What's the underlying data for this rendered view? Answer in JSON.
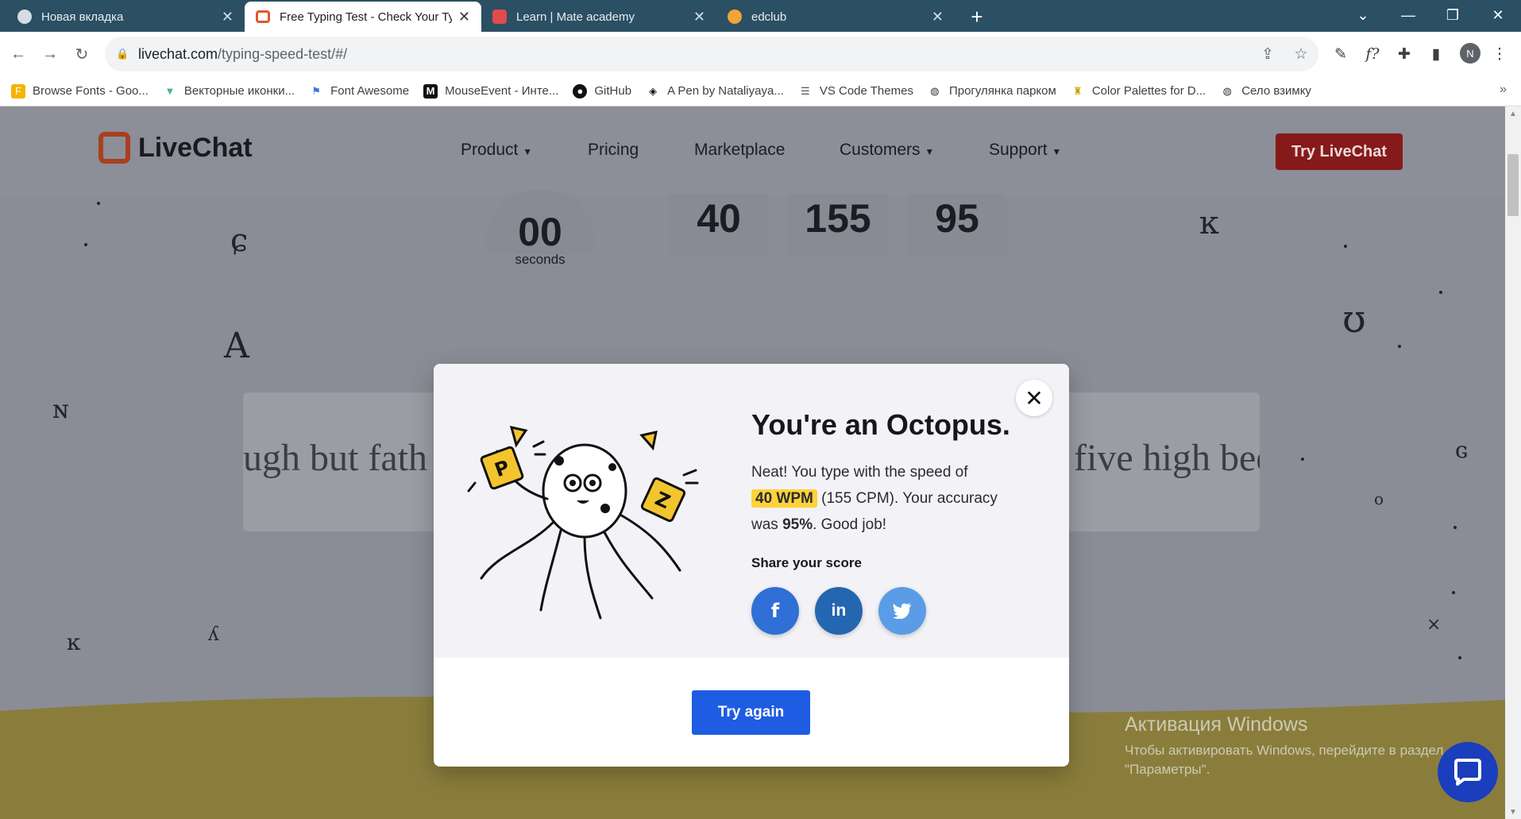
{
  "browser": {
    "tabs": [
      {
        "title": "Новая вкладка",
        "active": false
      },
      {
        "title": "Free Typing Test - Check Your Ty",
        "active": true
      },
      {
        "title": "Learn | Mate academy",
        "active": false
      },
      {
        "title": "edclub",
        "active": false
      }
    ],
    "url_domain": "livechat.com",
    "url_path": "/typing-speed-test/#/",
    "profile_initial": "N",
    "bookmarks": [
      {
        "label": "Browse Fonts - Goo...",
        "icon": "google-fonts-icon"
      },
      {
        "label": "Векторные иконки...",
        "icon": "vue-icon"
      },
      {
        "label": "Font Awesome",
        "icon": "flag-icon"
      },
      {
        "label": "MouseEvent - Инте...",
        "icon": "mdn-icon"
      },
      {
        "label": "GitHub",
        "icon": "github-icon"
      },
      {
        "label": "A Pen by Nataliyaya...",
        "icon": "codepen-icon"
      },
      {
        "label": "VS Code Themes",
        "icon": "vscode-icon"
      },
      {
        "label": "Прогулянка парком",
        "icon": "globe-icon"
      },
      {
        "label": "Color Palettes for D...",
        "icon": "trophy-icon"
      },
      {
        "label": "Село взимку",
        "icon": "globe-icon"
      }
    ]
  },
  "site": {
    "logo": "LiveChat",
    "nav": [
      "Product",
      "Pricing",
      "Marketplace",
      "Customers",
      "Support"
    ],
    "cta": "Try LiveChat"
  },
  "stats": {
    "seconds": "00",
    "seconds_label": "seconds",
    "wpm": "40",
    "cpm": "155",
    "accuracy": "95"
  },
  "typing": {
    "left_text": "ugh but fath",
    "right_text": "five high bee"
  },
  "modal": {
    "title": "You're an Octopus.",
    "line1": "Neat! You type with the speed of",
    "wpm_badge": "40 WPM",
    "line2": " (155 CPM). Your accuracy",
    "line3_pre": "was ",
    "accuracy": "95%",
    "line3_post": ". Good job!",
    "share_label": "Share your score",
    "share": [
      "facebook",
      "linkedin",
      "twitter"
    ],
    "try_again": "Try again"
  },
  "watermark": {
    "title": "Активация Windows",
    "line1": "Чтобы активировать Windows, перейдите в раздел",
    "line2": "\"Параметры\"."
  },
  "colors": {
    "tabstrip": "#2b4f63",
    "cta": "#861a1a",
    "badge": "#ffd23a",
    "try_again": "#1e5ce3",
    "facebook": "#2f6fd6",
    "linkedin": "#2566b0",
    "twitter": "#5a9de6",
    "chat": "#1a3ebc"
  }
}
